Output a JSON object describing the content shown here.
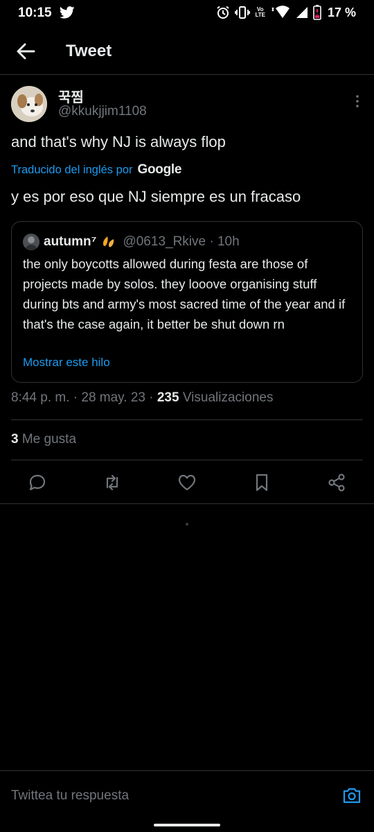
{
  "status_bar": {
    "time": "10:15",
    "network_label_top": "Vo",
    "network_label_bottom": "LTE",
    "battery_percent": "17 %",
    "icons": [
      "twitter-icon",
      "alarm-icon",
      "vibrate-icon",
      "wifi-icon",
      "signal-icon",
      "battery-icon"
    ]
  },
  "header": {
    "title": "Tweet",
    "back_icon": "arrow-left-icon"
  },
  "tweet": {
    "author_name": "꾹찜",
    "author_handle": "@kkukjjim1108",
    "text": "and that's why NJ is always flop",
    "translation_label": "Traducido del inglés por",
    "translation_provider": "Google",
    "translated_text": "y es por eso que NJ siempre es un fracaso",
    "timestamp": "8:44 p. m. · 28 may. 23 · ",
    "views_count": "235",
    "views_label": " Visualizaciones",
    "likes_count": "3",
    "likes_label": " Me gusta"
  },
  "quoted_tweet": {
    "author_name": "autumn⁷",
    "author_handle": "@0613_Rkive · 10h",
    "text": "the only boycotts allowed during festa are those of projects made by solos. they looove organising stuff during bts and army's most sacred time of the year and if that's the case again, it better be shut down rn",
    "show_thread": "Mostrar este hilo"
  },
  "actions": [
    "reply-icon",
    "retweet-icon",
    "like-icon",
    "bookmark-icon",
    "share-icon"
  ],
  "reply": {
    "placeholder": "Twittea tu respuesta"
  },
  "colors": {
    "background": "#000000",
    "text": "#e7e9ea",
    "secondary": "#71767b",
    "accent": "#1d9bf0",
    "border": "#2f3336"
  }
}
